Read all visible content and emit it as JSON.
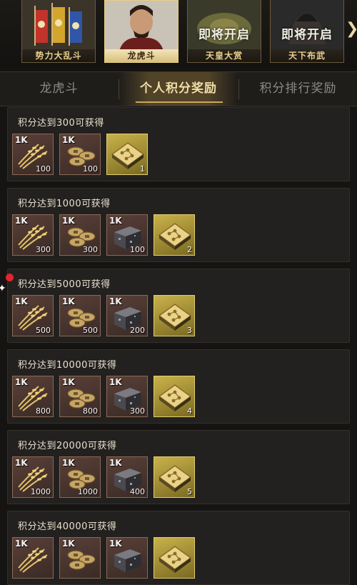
{
  "events": [
    {
      "name": "势力大乱斗",
      "selected": false,
      "overlay": ""
    },
    {
      "name": "龙虎斗",
      "selected": true,
      "overlay": ""
    },
    {
      "name": "天皇大赏",
      "selected": false,
      "overlay": "即将开启"
    },
    {
      "name": "天下布武",
      "selected": false,
      "overlay": "即将开启"
    }
  ],
  "tabs": [
    {
      "label": "龙虎斗",
      "active": false
    },
    {
      "label": "个人积分奖励",
      "active": true
    },
    {
      "label": "积分排行奖励",
      "active": false
    }
  ],
  "item_badge": "1K",
  "rewards": [
    {
      "title": "积分达到300可获得",
      "items": [
        {
          "type": "rice-icon",
          "qty": "100"
        },
        {
          "type": "coins-icon",
          "qty": "100"
        },
        {
          "type": "scroll-box-icon",
          "qty": "1"
        }
      ]
    },
    {
      "title": "积分达到1000可获得",
      "items": [
        {
          "type": "rice-icon",
          "qty": "300"
        },
        {
          "type": "coins-icon",
          "qty": "300"
        },
        {
          "type": "iron-ore-icon",
          "qty": "100"
        },
        {
          "type": "scroll-box-icon",
          "qty": "2"
        }
      ]
    },
    {
      "title": "积分达到5000可获得",
      "items": [
        {
          "type": "rice-icon",
          "qty": "500"
        },
        {
          "type": "coins-icon",
          "qty": "500"
        },
        {
          "type": "iron-ore-icon",
          "qty": "200"
        },
        {
          "type": "scroll-box-icon",
          "qty": "3"
        }
      ]
    },
    {
      "title": "积分达到10000可获得",
      "items": [
        {
          "type": "rice-icon",
          "qty": "800"
        },
        {
          "type": "coins-icon",
          "qty": "800"
        },
        {
          "type": "iron-ore-icon",
          "qty": "300"
        },
        {
          "type": "scroll-box-icon",
          "qty": "4"
        }
      ]
    },
    {
      "title": "积分达到20000可获得",
      "items": [
        {
          "type": "rice-icon",
          "qty": "1000"
        },
        {
          "type": "coins-icon",
          "qty": "1000"
        },
        {
          "type": "iron-ore-icon",
          "qty": "400"
        },
        {
          "type": "scroll-box-icon",
          "qty": "5"
        }
      ]
    },
    {
      "title": "积分达到40000可获得",
      "items": [
        {
          "type": "rice-icon",
          "qty": ""
        },
        {
          "type": "coins-icon",
          "qty": ""
        },
        {
          "type": "iron-ore-icon",
          "qty": ""
        },
        {
          "type": "scroll-box-icon",
          "qty": ""
        }
      ]
    }
  ],
  "colors": {
    "accent_gold": "#e8cf83",
    "item_frame": "#8a6a55",
    "rare_frame": "#e1cf72",
    "notice_dot": "#e2262a"
  }
}
